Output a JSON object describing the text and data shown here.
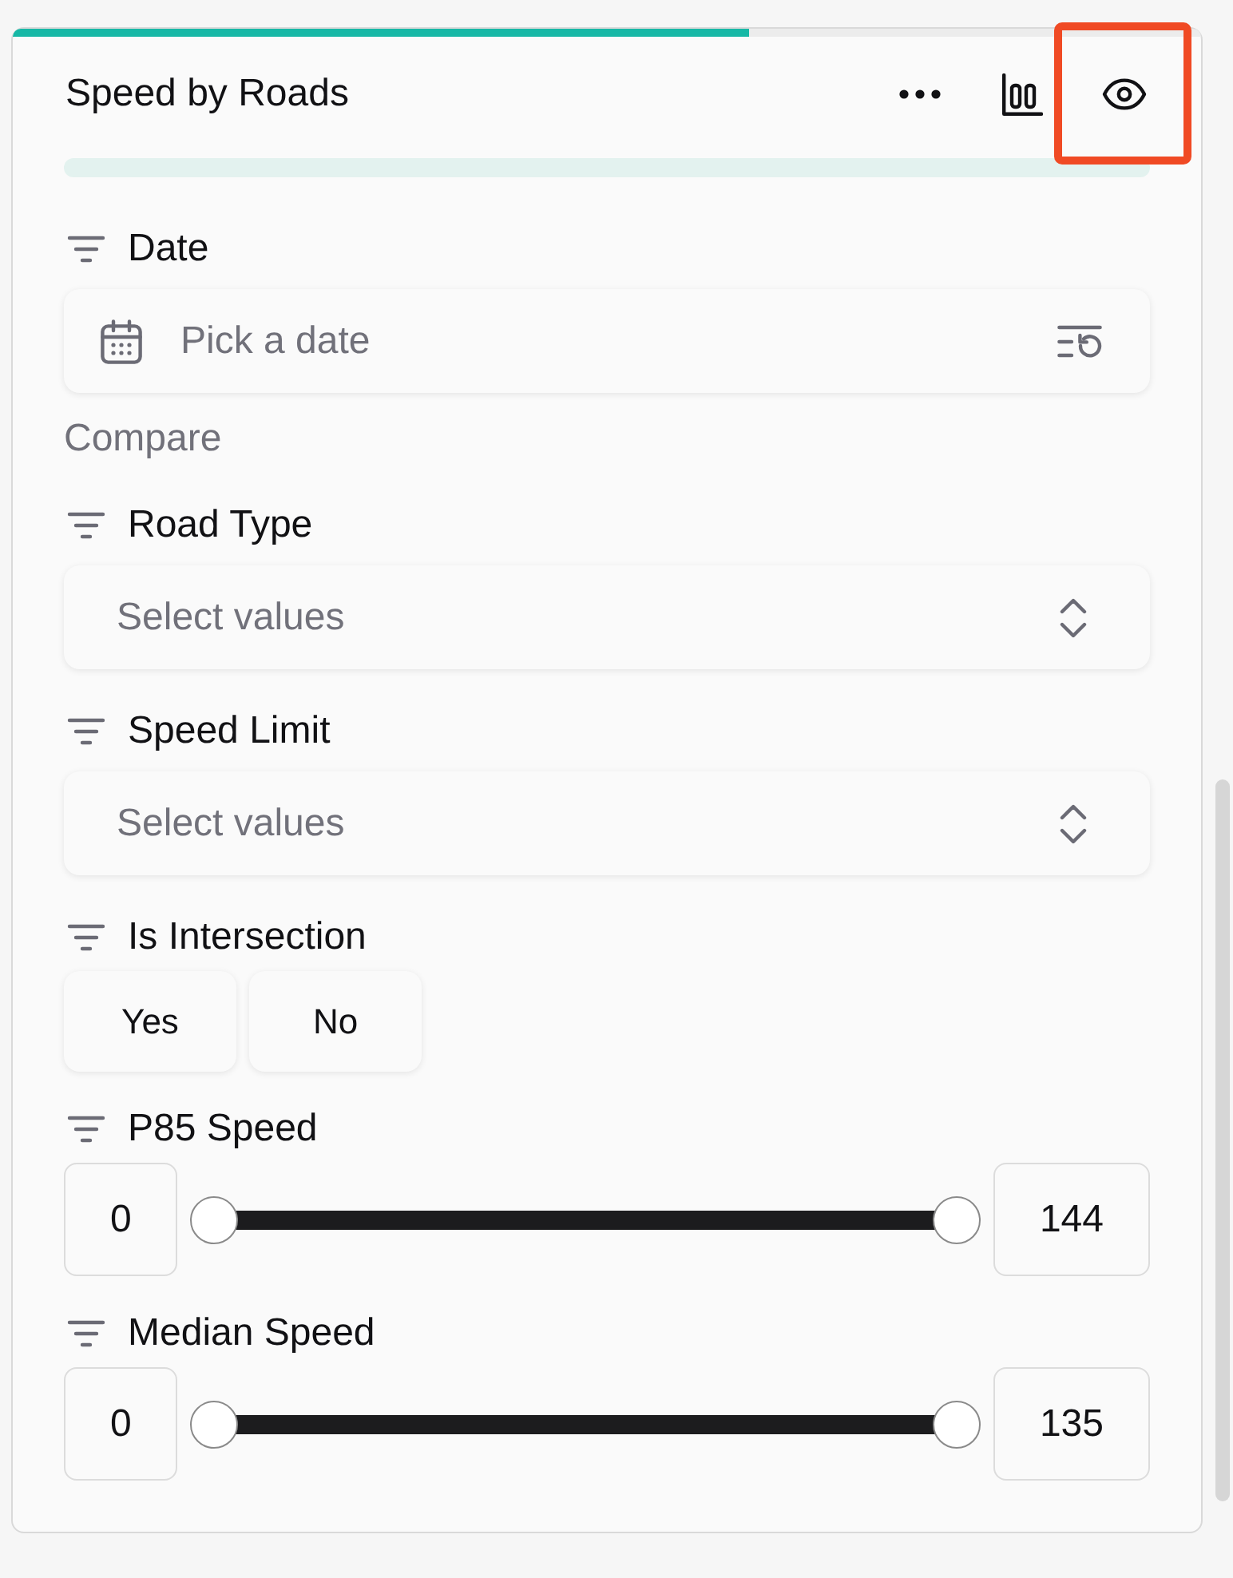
{
  "panel": {
    "title": "Speed by Roads",
    "loading": {
      "level": 0.62
    },
    "actions": [
      {
        "kind": "more",
        "highlighted": false
      },
      {
        "kind": "chart",
        "highlighted": false
      },
      {
        "kind": "view",
        "highlighted": true
      }
    ]
  },
  "filters": [
    {
      "kind": "date",
      "label": "Date",
      "placeholder": "Pick a date",
      "compare": "Compare"
    },
    {
      "kind": "select",
      "label": "Road Type",
      "placeholder": "Select values"
    },
    {
      "kind": "select",
      "label": "Speed Limit",
      "placeholder": "Select values"
    },
    {
      "kind": "toggle",
      "label": "Is Intersection",
      "options": [
        {
          "label": "Yes",
          "selected": false
        },
        {
          "label": "No",
          "selected": false
        }
      ]
    },
    {
      "kind": "range",
      "label": "P85 Speed",
      "min": "0",
      "max": "144",
      "thumbs": [
        {
          "level": 0
        },
        {
          "level": 1
        }
      ]
    },
    {
      "kind": "range",
      "label": "Median Speed",
      "min": "0",
      "max": "135",
      "thumbs": [
        {
          "level": 0
        },
        {
          "level": 1
        }
      ]
    }
  ]
}
